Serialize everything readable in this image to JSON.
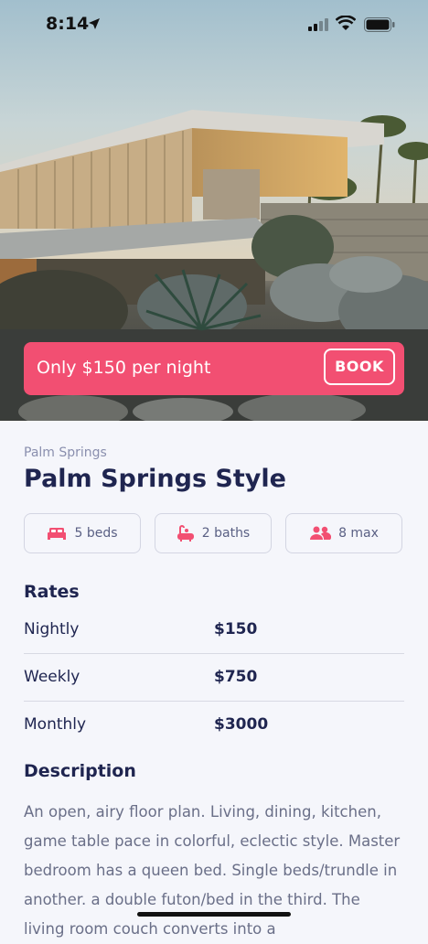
{
  "status": {
    "time": "8:14"
  },
  "booking": {
    "text": "Only $150 per night",
    "button": "BOOK"
  },
  "listing": {
    "location": "Palm Springs",
    "title": "Palm Springs Style",
    "features": [
      {
        "icon": "bed-icon",
        "label": "5 beds"
      },
      {
        "icon": "bath-icon",
        "label": "2 baths"
      },
      {
        "icon": "people-icon",
        "label": "8 max"
      }
    ]
  },
  "rates": {
    "heading": "Rates",
    "rows": [
      {
        "label": "Nightly",
        "value": "$150"
      },
      {
        "label": "Weekly",
        "value": "$750"
      },
      {
        "label": "Monthly",
        "value": "$3000"
      }
    ]
  },
  "description": {
    "heading": "Description",
    "text": "An open, airy floor plan. Living, dining, kitchen, game table pace in colorful, eclectic style. Master bedroom has a queen bed. Single beds/trundle in another. a double futon/bed in the third. The living room couch converts into a"
  },
  "colors": {
    "accent": "#f24f72",
    "heading": "#1f2550",
    "background": "#f5f6fb"
  }
}
